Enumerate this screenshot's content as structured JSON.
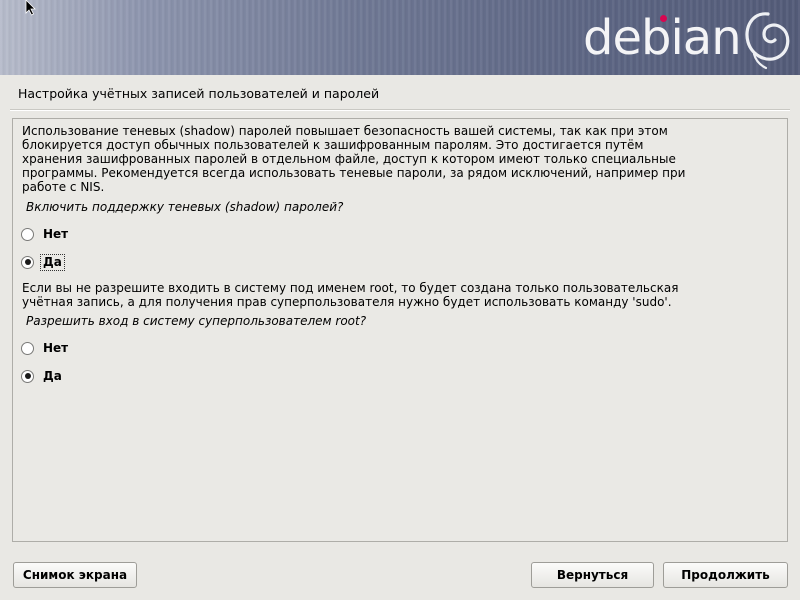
{
  "banner": {
    "logo_text": "debian",
    "logo_dot_color": "#d70751"
  },
  "page": {
    "title": "Настройка учётных записей пользователей и паролей"
  },
  "shadow": {
    "description": [
      "Использование теневых (shadow) паролей повышает безопасность вашей системы, так как при этом",
      "блокируется доступ обычных пользователей к зашифрованным паролям. Это достигается путём",
      "хранения зашифрованных паролей в отдельном файле, доступ к котором имеют только специальные",
      "программы. Рекомендуется всегда использовать теневые пароли, за рядом исключений, например при",
      "работе с NIS."
    ],
    "question": "Включить поддержку теневых (shadow) паролей?",
    "options": [
      {
        "label": "Нет",
        "selected": false
      },
      {
        "label": "Да",
        "selected": true
      }
    ]
  },
  "root": {
    "description": [
      "Если вы не разрешите входить в систему под именем root, то будет создана только пользовательская",
      "учётная запись, а для получения прав суперпользователя нужно будет использовать команду 'sudo'."
    ],
    "question": "Разрешить вход в систему суперпользователем root?",
    "options": [
      {
        "label": "Нет",
        "selected": false
      },
      {
        "label": "Да",
        "selected": true
      }
    ]
  },
  "buttons": {
    "screenshot": "Снимок экрана",
    "back": "Вернуться",
    "continue": "Продолжить"
  }
}
